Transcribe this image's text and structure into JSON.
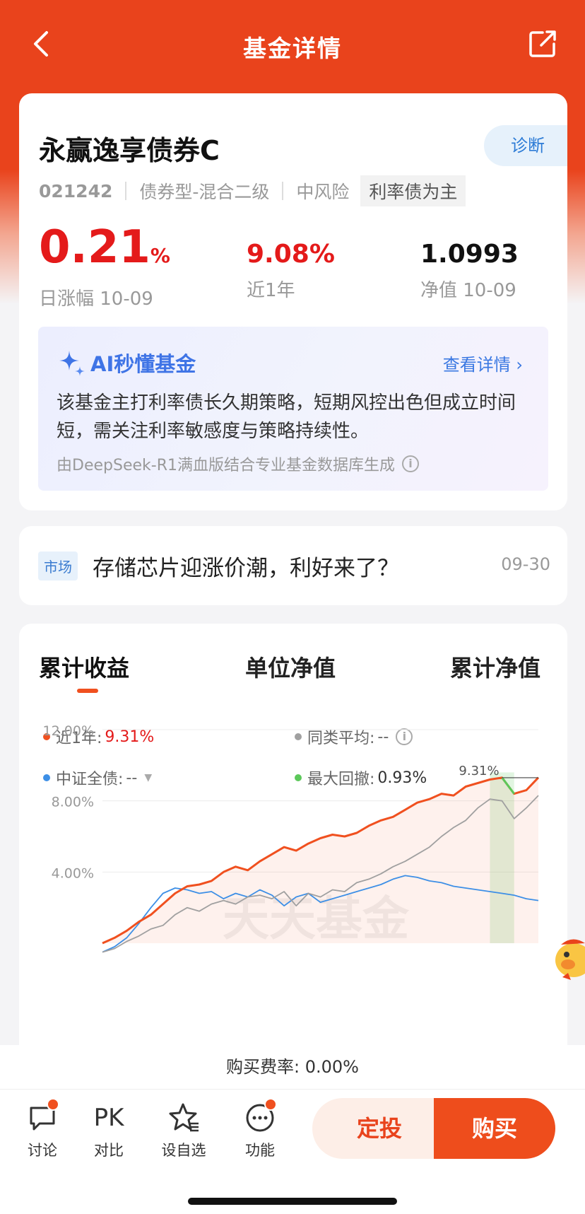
{
  "header": {
    "title": "基金详情"
  },
  "fund": {
    "name": "永赢逸享债券C",
    "diagnose_label": "诊断",
    "code": "021242",
    "type": "债券型-混合二级",
    "risk": "中风险",
    "tag": "利率债为主",
    "daily_change_value": "0.21",
    "daily_change_unit": "%",
    "daily_change_label": "日涨幅 10-09",
    "year_return": "9.08%",
    "year_label": "近1年",
    "nav": "1.0993",
    "nav_label": "净值 10-09"
  },
  "ai": {
    "title": "AI秒懂基金",
    "more": "查看详情",
    "text": "该基金主打利率债长久期策略，短期风控出色但成立时间短，需关注利率敏感度与策略持续性。",
    "source": "由DeepSeek-R1满血版结合专业基金数据库生成"
  },
  "news": {
    "tag": "市场",
    "text": "存储芯片迎涨价潮，利好来了？",
    "date": "09-30"
  },
  "tabs": [
    "累计收益",
    "单位净值",
    "累计净值"
  ],
  "legend": {
    "year": {
      "label": "近1年:",
      "value": "9.31%"
    },
    "avg": {
      "label": "同类平均:",
      "value": "--"
    },
    "index": {
      "label": "中证全债:",
      "value": "--"
    },
    "drawdown": {
      "label": "最大回撤:",
      "value": "0.93%"
    }
  },
  "chart_data": {
    "type": "line",
    "y_ticks": [
      "12.00%",
      "8.00%",
      "4.00%"
    ],
    "ylim": [
      0,
      12
    ],
    "peak_label": "9.31%",
    "watermark": "天天基金",
    "series": [
      {
        "name": "近1年",
        "color": "#f0501f",
        "values": [
          0,
          0.3,
          0.7,
          1.2,
          1.6,
          2.2,
          2.8,
          3.2,
          3.3,
          3.5,
          4.0,
          4.3,
          4.1,
          4.6,
          5.0,
          5.4,
          5.2,
          5.6,
          5.9,
          6.1,
          6.0,
          6.2,
          6.6,
          6.9,
          7.1,
          7.5,
          7.9,
          8.1,
          8.4,
          8.3,
          8.8,
          9.0,
          9.2,
          9.3,
          8.4,
          8.6,
          9.31
        ]
      },
      {
        "name": "同类平均",
        "color": "#a0a0a0",
        "values": [
          -0.5,
          -0.3,
          0.1,
          0.4,
          0.8,
          1.0,
          1.6,
          2.0,
          1.8,
          2.2,
          2.4,
          2.2,
          2.6,
          2.7,
          2.5,
          2.9,
          2.1,
          2.8,
          2.6,
          3.0,
          2.9,
          3.4,
          3.6,
          3.9,
          4.3,
          4.6,
          5.0,
          5.4,
          6.0,
          6.5,
          6.9,
          7.6,
          8.1,
          8.0,
          7.0,
          7.6,
          8.3
        ]
      },
      {
        "name": "中证全债",
        "color": "#3d8fe6",
        "values": [
          -0.5,
          -0.2,
          0.3,
          1.1,
          2.0,
          2.8,
          3.1,
          3.0,
          2.8,
          2.9,
          2.5,
          2.8,
          2.6,
          3.0,
          2.7,
          2.1,
          2.6,
          2.8,
          2.3,
          2.5,
          2.7,
          2.9,
          3.1,
          3.3,
          3.6,
          3.8,
          3.7,
          3.5,
          3.4,
          3.2,
          3.1,
          3.0,
          2.9,
          2.8,
          2.7,
          2.5,
          2.4
        ]
      }
    ]
  },
  "fee": "购买费率: 0.00%",
  "bottom": {
    "discuss": "讨论",
    "pk_icon": "PK",
    "compare": "对比",
    "watch": "设自选",
    "function": "功能",
    "ding": "定投",
    "buy": "购买"
  },
  "colors": {
    "brand": "#e9431c",
    "rise": "#e41a1a",
    "link": "#3a78e2"
  }
}
